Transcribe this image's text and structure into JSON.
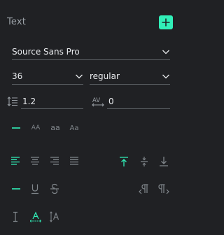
{
  "panel": {
    "title": "Text",
    "add_icon": "plus-icon",
    "accent_color": "#31efb8"
  },
  "font": {
    "family": "Source Sans Pro",
    "size": "36",
    "weight": "regular",
    "line_height": "1.2",
    "letter_spacing": "0"
  },
  "case_row": {
    "none_icon": "dash-icon",
    "uppercase_label": "AA",
    "lowercase_label": "aa",
    "titlecase_label": "Aa"
  },
  "align_row": {
    "horizontal": [
      "align-left-icon",
      "align-center-icon",
      "align-right-icon",
      "align-justify-icon"
    ],
    "vertical": [
      "align-top-icon",
      "align-middle-icon",
      "align-bottom-icon"
    ]
  },
  "decoration_row": {
    "icons": [
      "dash-icon",
      "underline-icon",
      "strikethrough-icon",
      "ltr-paragraph-icon",
      "rtl-paragraph-icon"
    ]
  },
  "resize_row": {
    "icons": [
      "text-cursor-icon",
      "auto-width-icon",
      "auto-height-icon"
    ]
  }
}
